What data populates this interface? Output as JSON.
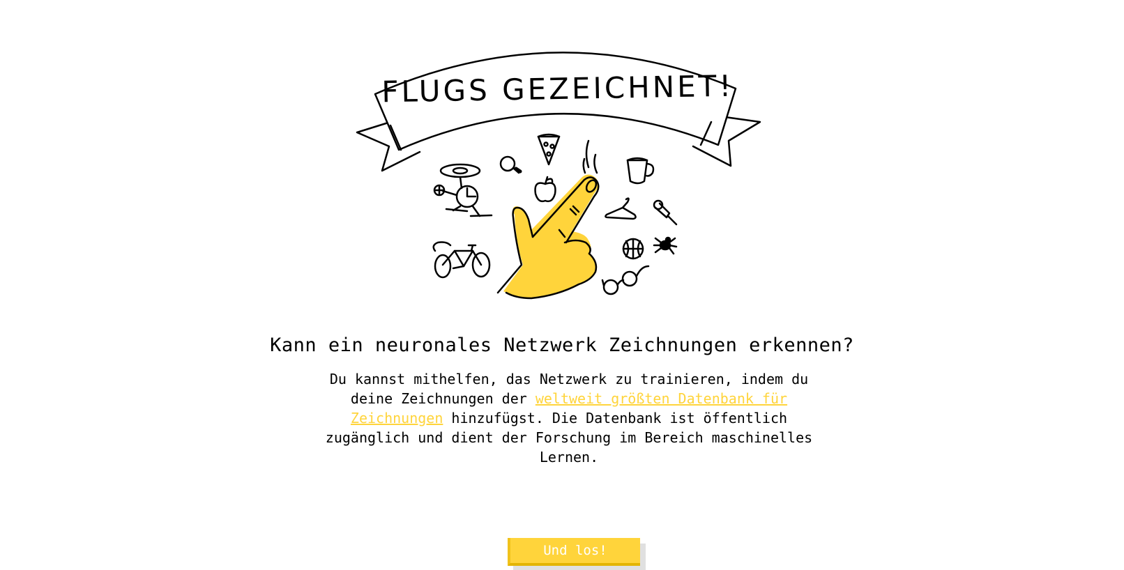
{
  "hero": {
    "banner_text": "FLUGS GEZEICHNET!",
    "accent_color": "#ffd43b",
    "doodle_icons": [
      "helicopter-icon",
      "lightbulb-icon",
      "pizza-icon",
      "apple-icon",
      "mug-icon",
      "hanger-icon",
      "pushpin-icon",
      "bicycle-icon",
      "basketball-icon",
      "spider-icon",
      "eyeglasses-icon",
      "pointing-hand-icon"
    ]
  },
  "main": {
    "headline": "Kann ein neuronales Netzwerk Zeichnungen erkennen?",
    "intro_before": "Du kannst mithelfen, das Netzwerk zu trainieren, indem du deine Zeichnungen der ",
    "intro_link": "weltweit größten Datenbank für Zeichnungen",
    "intro_after": " hinzufügst. Die Datenbank ist öffentlich zugänglich und dient der Forschung im Bereich maschinelles Lernen.",
    "start_button": "Und los!"
  }
}
